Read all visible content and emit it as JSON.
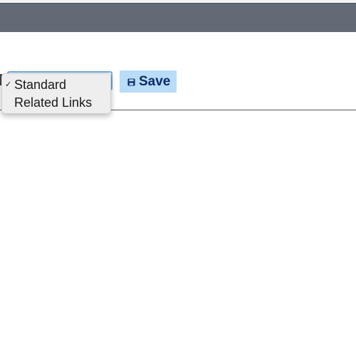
{
  "dropdown": {
    "selected_value": "Standard",
    "options": [
      {
        "label": "Standard",
        "checked": true
      },
      {
        "label": "Related Links",
        "checked": false
      }
    ],
    "check_glyph": "✓",
    "arrows_glyph": "⇕"
  },
  "toolbar": {
    "save_label": "Save",
    "save_icon": "save-icon",
    "save_bg": "#b9dcf7",
    "save_color": "#0c2a6b"
  },
  "colors": {
    "top_bar": "#626a76",
    "select_border": "#6fa8dc"
  }
}
